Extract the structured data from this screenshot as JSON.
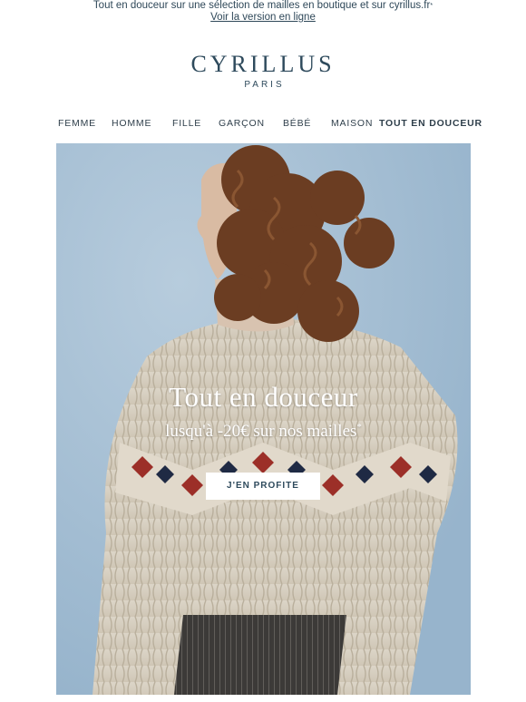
{
  "preheader": {
    "text": "Tout en douceur sur une sélection de mailles en boutique et sur cyrillus.fr",
    "asterisk": "*",
    "view_online_link": "Voir la version en ligne"
  },
  "logo": {
    "brand": "CYRILLUS",
    "city": "PARIS"
  },
  "nav": {
    "items": [
      {
        "label": "FEMME"
      },
      {
        "label": "HOMME"
      },
      {
        "label": "FILLE"
      },
      {
        "label": "GARÇON"
      },
      {
        "label": "BÉBÉ"
      },
      {
        "label": "MAISON"
      },
      {
        "label": "TOUT EN DOUCEUR"
      }
    ]
  },
  "hero": {
    "title": "Tout en douceur",
    "subtitle": "lusqu'à -20€ sur nos mailles",
    "subtitle_asterisk": "*",
    "cta_label": "J'EN PROFITE"
  },
  "colors": {
    "brand": "#2e4a5c",
    "sky": "#a9c2d6",
    "sweater": "#d8d0c2",
    "hair": "#6b3d22",
    "pattern_red": "#9c2f28",
    "pattern_navy": "#1f2a44"
  }
}
